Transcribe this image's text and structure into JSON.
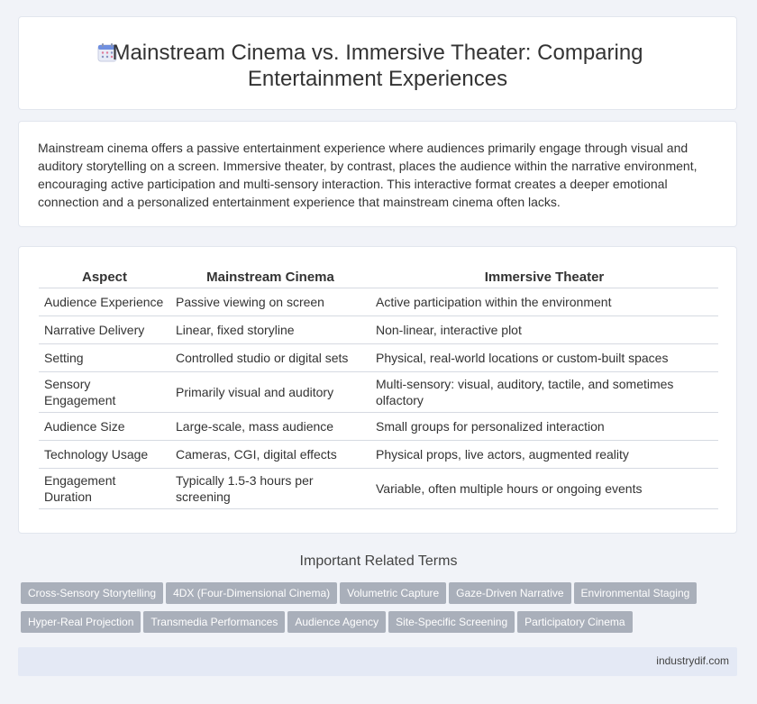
{
  "header": {
    "title_line1": "Mainstream Cinema vs. Immersive Theater: Comparing",
    "title_line2": "Entertainment Experiences",
    "icon": "calendar-icon"
  },
  "intro": {
    "text": "Mainstream cinema offers a passive entertainment experience where audiences primarily engage through visual and auditory storytelling on a screen. Immersive theater, by contrast, places the audience within the narrative environment, encouraging active participation and multi-sensory interaction. This interactive format creates a deeper emotional connection and a personalized entertainment experience that mainstream cinema often lacks."
  },
  "table": {
    "headers": [
      "Aspect",
      "Mainstream Cinema",
      "Immersive Theater"
    ],
    "rows": [
      [
        "Audience Experience",
        "Passive viewing on screen",
        "Active participation within the environment"
      ],
      [
        "Narrative Delivery",
        "Linear, fixed storyline",
        "Non-linear, interactive plot"
      ],
      [
        "Setting",
        "Controlled studio or digital sets",
        "Physical, real-world locations or custom-built spaces"
      ],
      [
        "Sensory Engagement",
        "Primarily visual and auditory",
        "Multi-sensory: visual, auditory, tactile, and sometimes olfactory"
      ],
      [
        "Audience Size",
        "Large-scale, mass audience",
        "Small groups for personalized interaction"
      ],
      [
        "Technology Usage",
        "Cameras, CGI, digital effects",
        "Physical props, live actors, augmented reality"
      ],
      [
        "Engagement Duration",
        "Typically 1.5-3 hours per screening",
        "Variable, often multiple hours or ongoing events"
      ]
    ]
  },
  "related": {
    "title": "Important Related Terms",
    "tags": [
      "Cross-Sensory Storytelling",
      "4DX (Four-Dimensional Cinema)",
      "Volumetric Capture",
      "Gaze-Driven Narrative",
      "Environmental Staging",
      "Hyper-Real Projection",
      "Transmedia Performances",
      "Audience Agency",
      "Site-Specific Screening",
      "Participatory Cinema"
    ]
  },
  "footer": {
    "site": "industrydif.com"
  }
}
